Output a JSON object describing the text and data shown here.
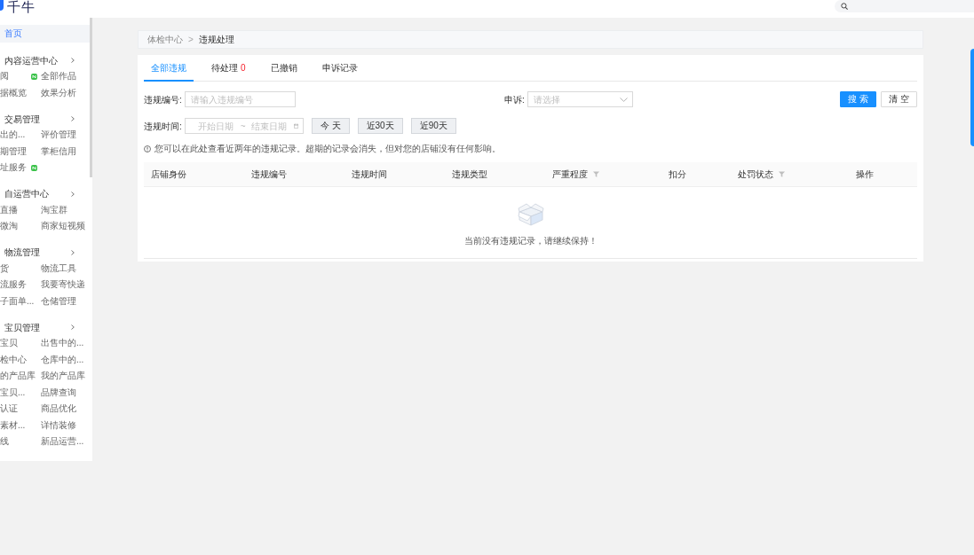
{
  "top_bar": {
    "logo_text": "千牛"
  },
  "sidebar": {
    "home": {
      "label": "首页",
      "selected": true
    },
    "sections": [
      {
        "title": "内容运营中心",
        "links": [
          {
            "label": "阅",
            "badge": true,
            "selected": false
          },
          {
            "label": "全部作品",
            "badge": false,
            "selected": false
          },
          {
            "label": "据概览",
            "badge": false,
            "selected": false
          },
          {
            "label": "效果分析",
            "badge": false,
            "selected": false
          }
        ]
      },
      {
        "title": "交易管理",
        "links": [
          {
            "label": "出的...",
            "badge": false,
            "selected": false
          },
          {
            "label": "评价管理",
            "badge": false,
            "selected": false
          },
          {
            "label": "期管理",
            "badge": false,
            "selected": false
          },
          {
            "label": "掌柜信用",
            "badge": false,
            "selected": false
          },
          {
            "label": "址服务",
            "badge": true,
            "selected": false
          }
        ]
      },
      {
        "title": "自运营中心",
        "links": [
          {
            "label": "直播",
            "badge": false,
            "selected": false
          },
          {
            "label": "淘宝群",
            "badge": false,
            "selected": false
          },
          {
            "label": "微淘",
            "badge": false,
            "selected": false
          },
          {
            "label": "商家短视频",
            "badge": false,
            "selected": false
          }
        ]
      },
      {
        "title": "物流管理",
        "links": [
          {
            "label": "货",
            "badge": false,
            "selected": false
          },
          {
            "label": "物流工具",
            "badge": false,
            "selected": false
          },
          {
            "label": "流服务",
            "badge": false,
            "selected": false
          },
          {
            "label": "我要寄快递",
            "badge": false,
            "selected": false
          },
          {
            "label": "子面单...",
            "badge": false,
            "selected": false
          },
          {
            "label": "仓储管理",
            "badge": false,
            "selected": false
          }
        ]
      },
      {
        "title": "宝贝管理",
        "links": [
          {
            "label": "宝贝",
            "badge": false,
            "selected": false
          },
          {
            "label": "出售中的...",
            "badge": false,
            "selected": false
          },
          {
            "label": "检中心",
            "badge": false,
            "selected": false
          },
          {
            "label": "仓库中的...",
            "badge": false,
            "selected": false
          },
          {
            "label": "的产品库",
            "badge": false,
            "selected": false
          },
          {
            "label": "我的产品库",
            "badge": false,
            "selected": false
          },
          {
            "label": "宝贝...",
            "badge": false,
            "selected": false
          },
          {
            "label": "品牌查询",
            "badge": false,
            "selected": false
          },
          {
            "label": "认证",
            "badge": false,
            "selected": false
          },
          {
            "label": "商品优化",
            "badge": false,
            "selected": false
          },
          {
            "label": "素材...",
            "badge": false,
            "selected": false
          },
          {
            "label": "详情装修",
            "badge": false,
            "selected": false
          },
          {
            "label": "线",
            "badge": false,
            "selected": false
          },
          {
            "label": "新品运营...",
            "badge": false,
            "selected": false
          }
        ]
      }
    ]
  },
  "breadcrumb": {
    "items": [
      {
        "label": "体检中心"
      },
      {
        "label": "违规处理"
      }
    ],
    "separator": ">"
  },
  "tabs": [
    {
      "label": "全部违规",
      "selected": true
    },
    {
      "label": "待处理",
      "count": "0",
      "selected": false
    },
    {
      "label": "已撤销",
      "selected": false
    },
    {
      "label": "申诉记录",
      "selected": false
    }
  ],
  "filters": {
    "violation_id": {
      "label": "违规编号:",
      "placeholder": "请输入违规编号"
    },
    "appeal": {
      "label": "申诉:",
      "placeholder": "请选择"
    },
    "actions": [
      {
        "label": "搜 索",
        "kind": "primary"
      },
      {
        "label": "清 空",
        "kind": "default"
      }
    ],
    "time": {
      "label": "违规时间:",
      "start_placeholder": "开始日期",
      "separator": "~",
      "end_placeholder": "结束日期"
    },
    "quick_ranges": [
      "今 天",
      "近30天",
      "近90天"
    ]
  },
  "notice": "您可以在此处查看近两年的违规记录。超期的记录会消失，但对您的店铺没有任何影响。",
  "table": {
    "columns": [
      {
        "label": "店铺身份",
        "filter": false
      },
      {
        "label": "违规编号",
        "filter": false
      },
      {
        "label": "违规时间",
        "filter": false
      },
      {
        "label": "违规类型",
        "filter": false
      },
      {
        "label": "严重程度",
        "filter": true
      },
      {
        "label": "扣分",
        "filter": false
      },
      {
        "label": "处罚状态",
        "filter": true
      },
      {
        "label": "操作",
        "filter": false
      }
    ],
    "empty_text": "当前没有违规记录，请继续保持！"
  }
}
